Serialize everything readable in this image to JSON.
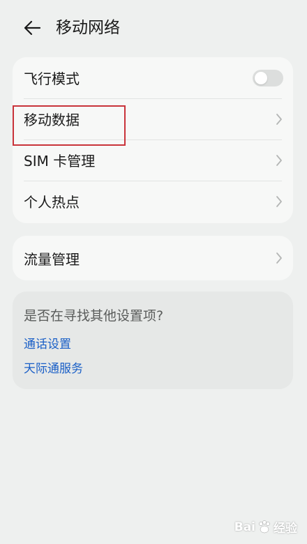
{
  "header": {
    "title": "移动网络",
    "back_icon": "arrow-left-icon"
  },
  "network_card": {
    "items": [
      {
        "label": "飞行模式",
        "control": "toggle",
        "toggle_on": false
      },
      {
        "label": "移动数据",
        "control": "chevron"
      },
      {
        "label": "SIM 卡管理",
        "control": "chevron"
      },
      {
        "label": "个人热点",
        "control": "chevron"
      }
    ]
  },
  "traffic_card": {
    "label": "流量管理"
  },
  "suggestions": {
    "title": "是否在寻找其他设置项?",
    "links": [
      "通话设置",
      "天际通服务"
    ]
  },
  "watermark": {
    "text_left": "Bai",
    "text_right": "经验"
  },
  "colors": {
    "background": "#eef0ef",
    "card": "#f7f8f7",
    "link": "#1a5fc7",
    "highlight": "#c9333a"
  }
}
